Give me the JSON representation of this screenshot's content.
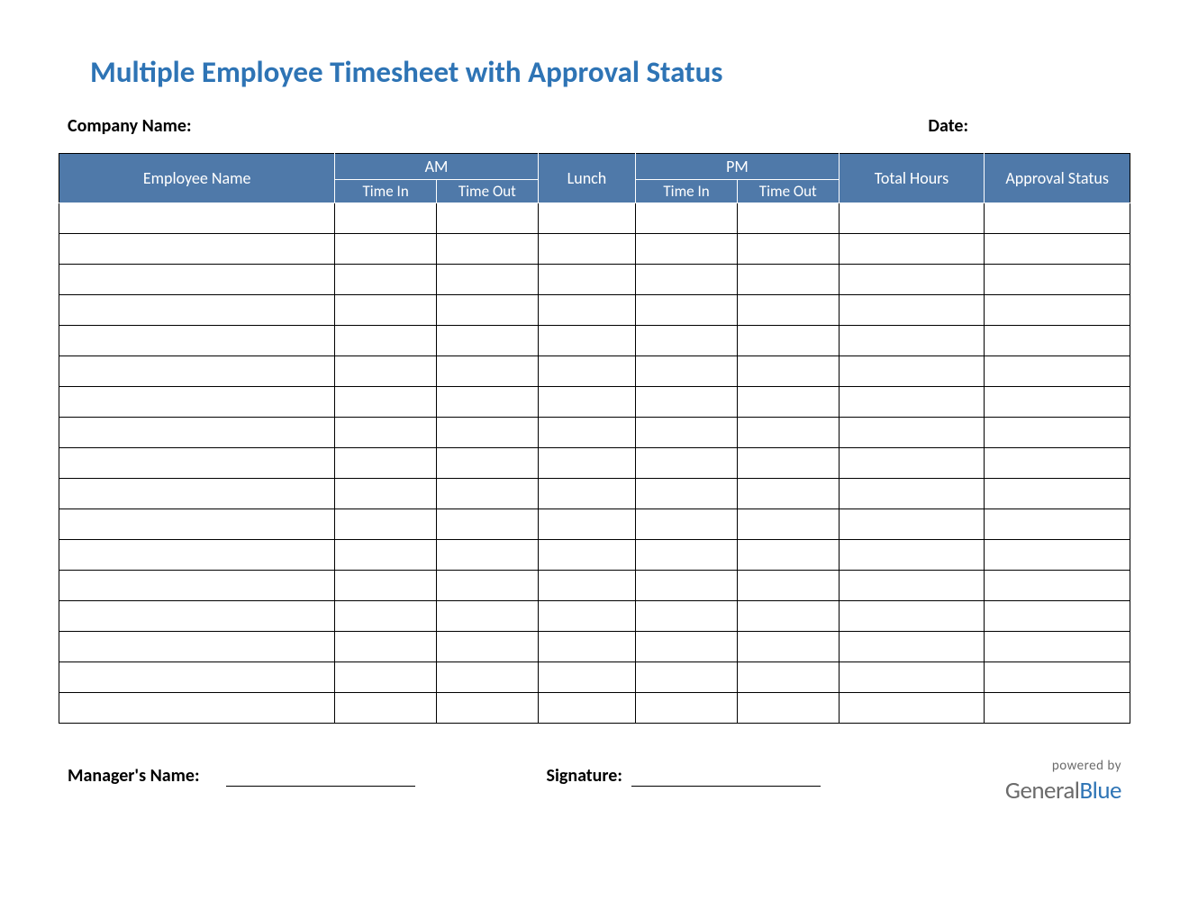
{
  "title": "Multiple Employee Timesheet with Approval Status",
  "labels": {
    "company": "Company Name:",
    "date": "Date:",
    "manager": "Manager's Name:",
    "signature": "Signature:"
  },
  "columns": {
    "employee_name": "Employee Name",
    "am": "AM",
    "pm": "PM",
    "time_in": "Time In",
    "time_out": "Time Out",
    "lunch": "Lunch",
    "total_hours": "Total Hours",
    "approval_status": "Approval Status"
  },
  "rows": [
    {
      "name": "",
      "am_in": "",
      "am_out": "",
      "lunch": "",
      "pm_in": "",
      "pm_out": "",
      "total": "",
      "approval": ""
    },
    {
      "name": "",
      "am_in": "",
      "am_out": "",
      "lunch": "",
      "pm_in": "",
      "pm_out": "",
      "total": "",
      "approval": ""
    },
    {
      "name": "",
      "am_in": "",
      "am_out": "",
      "lunch": "",
      "pm_in": "",
      "pm_out": "",
      "total": "",
      "approval": ""
    },
    {
      "name": "",
      "am_in": "",
      "am_out": "",
      "lunch": "",
      "pm_in": "",
      "pm_out": "",
      "total": "",
      "approval": ""
    },
    {
      "name": "",
      "am_in": "",
      "am_out": "",
      "lunch": "",
      "pm_in": "",
      "pm_out": "",
      "total": "",
      "approval": ""
    },
    {
      "name": "",
      "am_in": "",
      "am_out": "",
      "lunch": "",
      "pm_in": "",
      "pm_out": "",
      "total": "",
      "approval": ""
    },
    {
      "name": "",
      "am_in": "",
      "am_out": "",
      "lunch": "",
      "pm_in": "",
      "pm_out": "",
      "total": "",
      "approval": ""
    },
    {
      "name": "",
      "am_in": "",
      "am_out": "",
      "lunch": "",
      "pm_in": "",
      "pm_out": "",
      "total": "",
      "approval": ""
    },
    {
      "name": "",
      "am_in": "",
      "am_out": "",
      "lunch": "",
      "pm_in": "",
      "pm_out": "",
      "total": "",
      "approval": ""
    },
    {
      "name": "",
      "am_in": "",
      "am_out": "",
      "lunch": "",
      "pm_in": "",
      "pm_out": "",
      "total": "",
      "approval": ""
    },
    {
      "name": "",
      "am_in": "",
      "am_out": "",
      "lunch": "",
      "pm_in": "",
      "pm_out": "",
      "total": "",
      "approval": ""
    },
    {
      "name": "",
      "am_in": "",
      "am_out": "",
      "lunch": "",
      "pm_in": "",
      "pm_out": "",
      "total": "",
      "approval": ""
    },
    {
      "name": "",
      "am_in": "",
      "am_out": "",
      "lunch": "",
      "pm_in": "",
      "pm_out": "",
      "total": "",
      "approval": ""
    },
    {
      "name": "",
      "am_in": "",
      "am_out": "",
      "lunch": "",
      "pm_in": "",
      "pm_out": "",
      "total": "",
      "approval": ""
    },
    {
      "name": "",
      "am_in": "",
      "am_out": "",
      "lunch": "",
      "pm_in": "",
      "pm_out": "",
      "total": "",
      "approval": ""
    },
    {
      "name": "",
      "am_in": "",
      "am_out": "",
      "lunch": "",
      "pm_in": "",
      "pm_out": "",
      "total": "",
      "approval": ""
    },
    {
      "name": "",
      "am_in": "",
      "am_out": "",
      "lunch": "",
      "pm_in": "",
      "pm_out": "",
      "total": "",
      "approval": ""
    }
  ],
  "brand": {
    "powered": "powered by",
    "name_part1": "General",
    "name_part2": "Blue"
  }
}
